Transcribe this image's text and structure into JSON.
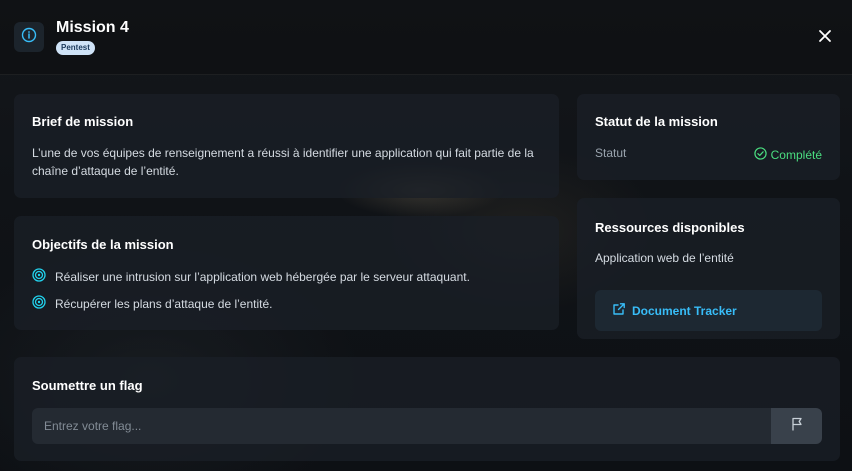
{
  "header": {
    "info_icon": "info-circle-icon",
    "title": "Mission 4",
    "badge": "Pentest",
    "close_icon": "close-icon"
  },
  "brief": {
    "title": "Brief de mission",
    "text": "L’une de vos équipes de renseignement a réussi à identifier une application qui fait partie de la chaîne d’attaque de l’entité."
  },
  "objectives": {
    "title": "Objectifs de la mission",
    "icon": "target-icon",
    "items": [
      "Réaliser une intrusion sur l’application web hébergée par le serveur attaquant.",
      "Récupérer les plans d’attaque de l’entité."
    ]
  },
  "status": {
    "title": "Statut de la mission",
    "label": "Statut",
    "value": "Complété",
    "value_icon": "check-circle-icon",
    "value_color": "#4ade80"
  },
  "resources": {
    "title": "Ressources disponibles",
    "description": "Application web de l’entité",
    "link_label": "Document Tracker",
    "link_icon": "external-link-icon",
    "link_color": "#38bdf8"
  },
  "flag": {
    "title": "Soumettre un flag",
    "placeholder": "Entrez votre flag...",
    "value": "",
    "submit_icon": "flag-icon"
  }
}
